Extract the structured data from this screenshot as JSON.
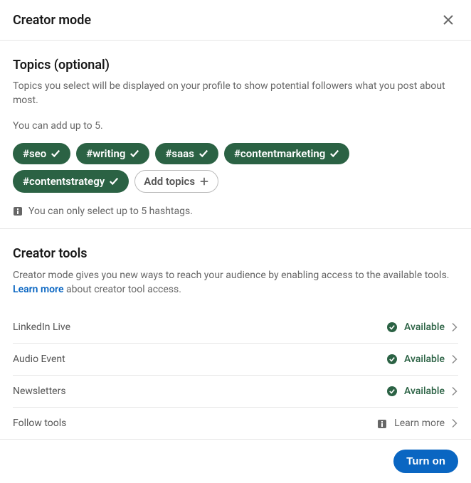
{
  "header": {
    "title": "Creator mode"
  },
  "topics": {
    "title": "Topics (optional)",
    "description": "Topics you select will be displayed on your profile to show potential followers what you post about most.",
    "limit_note": "You can add up to 5.",
    "items": [
      {
        "label": "#seo"
      },
      {
        "label": "#writing"
      },
      {
        "label": "#saas"
      },
      {
        "label": "#contentmarketing"
      },
      {
        "label": "#contentstrategy"
      }
    ],
    "add_label": "Add topics",
    "warning": "You can only select up to 5 hashtags."
  },
  "tools": {
    "title": "Creator tools",
    "description_before_link": "Creator mode gives you new ways to reach your audience by enabling access to the available tools. ",
    "link_text": "Learn more",
    "description_after_link": " about creator tool access.",
    "items": [
      {
        "label": "LinkedIn Live",
        "status": "Available",
        "type": "available"
      },
      {
        "label": "Audio Event",
        "status": "Available",
        "type": "available"
      },
      {
        "label": "Newsletters",
        "status": "Available",
        "type": "available"
      },
      {
        "label": "Follow tools",
        "status": "Learn more",
        "type": "learn"
      }
    ]
  },
  "footer": {
    "primary": "Turn on"
  }
}
